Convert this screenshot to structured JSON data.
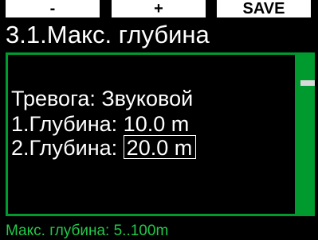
{
  "softkeys": {
    "minus_label": "-",
    "plus_label": "+",
    "save_label": "SAVE"
  },
  "header": {
    "title": "3.1.Макс. глубина"
  },
  "settings": {
    "alarm_label": "Тревога:",
    "alarm_value": "Звуковой",
    "depth1_label": "1.Глубина:",
    "depth1_value": "10.0 m",
    "depth2_label": "2.Глубина:",
    "depth2_value": "20.0 m"
  },
  "footer": {
    "hint": "Макс. глубина: 5..100m"
  },
  "colors": {
    "accent": "#009a2e",
    "hint": "#22c94a",
    "background": "#000000",
    "text": "#ffffff"
  }
}
